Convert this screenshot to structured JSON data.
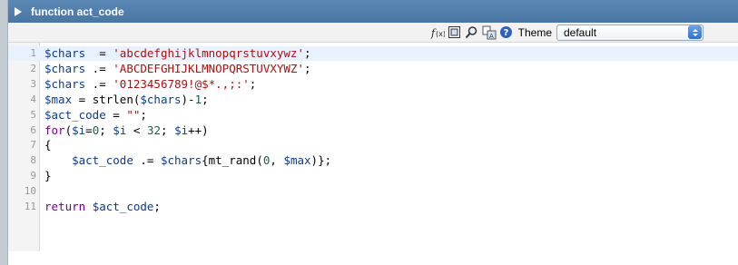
{
  "window": {
    "title": "function act_code"
  },
  "toolbar": {
    "icons": [
      "function-icon",
      "fullscreen-icon",
      "search-icon",
      "replace-icon",
      "help-icon"
    ],
    "theme_label": "Theme",
    "theme_value": "default"
  },
  "editor": {
    "lines": [
      {
        "num": "1",
        "tokens": [
          [
            "v",
            "$chars"
          ],
          [
            "p",
            "  = "
          ],
          [
            "s",
            "'abcdefghijklmnopqrstuvxywz'"
          ],
          [
            "p",
            ";"
          ]
        ]
      },
      {
        "num": "2",
        "tokens": [
          [
            "v",
            "$chars"
          ],
          [
            "p",
            " .= "
          ],
          [
            "s",
            "'ABCDEFGHIJKLMNOPQRSTUVXYWZ'"
          ],
          [
            "p",
            ";"
          ]
        ]
      },
      {
        "num": "3",
        "tokens": [
          [
            "v",
            "$chars"
          ],
          [
            "p",
            " .= "
          ],
          [
            "s",
            "'0123456789!@$*.,;:'"
          ],
          [
            "p",
            ";"
          ]
        ]
      },
      {
        "num": "4",
        "tokens": [
          [
            "v",
            "$max"
          ],
          [
            "p",
            " = "
          ],
          [
            "p",
            "strlen("
          ],
          [
            "v",
            "$chars"
          ],
          [
            "p",
            ")-"
          ],
          [
            "n",
            "1"
          ],
          [
            "p",
            ";"
          ]
        ]
      },
      {
        "num": "5",
        "tokens": [
          [
            "v",
            "$act_code"
          ],
          [
            "p",
            " = "
          ],
          [
            "s",
            "\"\""
          ],
          [
            "p",
            ";"
          ]
        ]
      },
      {
        "num": "6",
        "tokens": [
          [
            "k",
            "for"
          ],
          [
            "p",
            "("
          ],
          [
            "v",
            "$i"
          ],
          [
            "p",
            "="
          ],
          [
            "n",
            "0"
          ],
          [
            "p",
            "; "
          ],
          [
            "v",
            "$i"
          ],
          [
            "p",
            " < "
          ],
          [
            "n",
            "32"
          ],
          [
            "p",
            "; "
          ],
          [
            "v",
            "$i"
          ],
          [
            "p",
            "++)"
          ]
        ]
      },
      {
        "num": "7",
        "tokens": [
          [
            "p",
            "{"
          ]
        ]
      },
      {
        "num": "8",
        "tokens": [
          [
            "p",
            "    "
          ],
          [
            "v",
            "$act_code"
          ],
          [
            "p",
            " .= "
          ],
          [
            "v",
            "$chars"
          ],
          [
            "p",
            "{mt_rand("
          ],
          [
            "n",
            "0"
          ],
          [
            "p",
            ", "
          ],
          [
            "v",
            "$max"
          ],
          [
            "p",
            ")};"
          ]
        ]
      },
      {
        "num": "9",
        "tokens": [
          [
            "p",
            "}"
          ]
        ]
      },
      {
        "num": "10",
        "tokens": []
      },
      {
        "num": "11",
        "tokens": [
          [
            "k",
            "return"
          ],
          [
            "p",
            " "
          ],
          [
            "v",
            "$act_code"
          ],
          [
            "p",
            ";"
          ]
        ]
      }
    ]
  }
}
